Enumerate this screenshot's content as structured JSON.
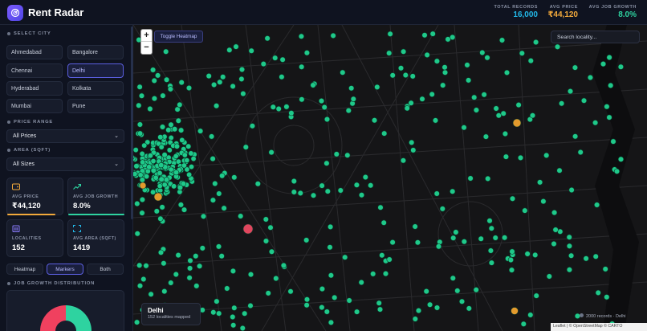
{
  "app": {
    "title": "Rent Radar"
  },
  "header_stats": [
    {
      "label": "TOTAL RECORDS",
      "value": "16,000",
      "color": "#22b8e8"
    },
    {
      "label": "AVG PRICE",
      "value": "₹44,120",
      "color": "#f2a93b"
    },
    {
      "label": "AVG JOB GROWTH",
      "value": "8.0%",
      "color": "#2ed3a0"
    }
  ],
  "sidebar": {
    "select_city_label": "SELECT CITY",
    "cities": [
      "Ahmedabad",
      "Bangalore",
      "Chennai",
      "Delhi",
      "Hyderabad",
      "Kolkata",
      "Mumbai",
      "Pune"
    ],
    "selected_city": "Delhi",
    "price_range_label": "PRICE RANGE",
    "price_range_value": "All Prices",
    "area_label": "AREA (SQFT)",
    "area_value": "All Sizes",
    "cards": [
      {
        "label": "AVG PRICE",
        "value": "₹44,120",
        "icon": "wallet-icon",
        "accent": "#f2a93b"
      },
      {
        "label": "AVG JOB GROWTH",
        "value": "8.0%",
        "icon": "trending-up-icon",
        "accent": "#2ed3a0"
      },
      {
        "label": "LOCALITIES",
        "value": "152",
        "icon": "building-icon",
        "accent": "#8b7cff"
      },
      {
        "label": "AVG AREA (SQFT)",
        "value": "1419",
        "icon": "expand-icon",
        "accent": "#22b8e8"
      }
    ],
    "view_modes": [
      "Heatmap",
      "Markers",
      "Both"
    ],
    "active_view_mode": "Markers",
    "job_growth_label": "JOB GROWTH DISTRIBUTION",
    "job_growth_colors": [
      "#f0415f",
      "#2ed3a0"
    ]
  },
  "map": {
    "toggle_label": "Toggle Heatmap",
    "zoom_in": "+",
    "zoom_out": "−",
    "search_placeholder": "Search locality...",
    "city_name": "Delhi",
    "city_sub": "152 localities mapped",
    "records_text": "2000 records · Delhi",
    "attribution": "Leaflet | © OpenStreetMap © CARTO",
    "marker_colors": {
      "high": "#1fc98a",
      "mid": "#e39a2d",
      "low": "#e0465e"
    }
  }
}
